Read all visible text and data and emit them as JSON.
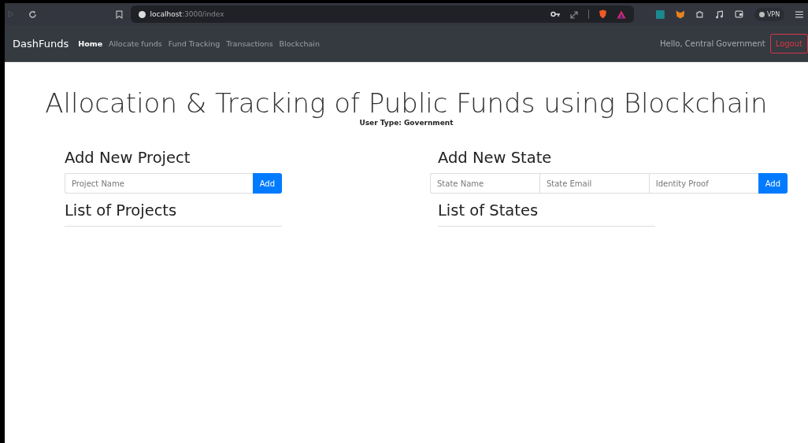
{
  "browser": {
    "url_host": "localhost",
    "url_path": ":3000/index",
    "vpn": "VPN"
  },
  "navbar": {
    "brand": "DashFunds",
    "links": [
      {
        "label": "Home",
        "selected": true
      },
      {
        "label": "Allocate funds",
        "selected": false
      },
      {
        "label": "Fund Tracking",
        "selected": false
      },
      {
        "label": "Transactions",
        "selected": false
      },
      {
        "label": "Blockchain",
        "selected": false
      }
    ],
    "greeting": "Hello, Central Government",
    "logout": "Logout"
  },
  "page": {
    "title": "Allocation & Tracking of Public Funds using Blockchain",
    "subtitle": "User Type: Government"
  },
  "projects": {
    "heading": "Add New Project",
    "fields": [
      {
        "placeholder": "Project Name"
      }
    ],
    "add": "Add",
    "list_heading": "List of Projects"
  },
  "states": {
    "heading": "Add New State",
    "fields": [
      {
        "placeholder": "State Name"
      },
      {
        "placeholder": "State Email"
      },
      {
        "placeholder": "Identity Proof"
      }
    ],
    "add": "Add",
    "list_heading": "List of States"
  }
}
